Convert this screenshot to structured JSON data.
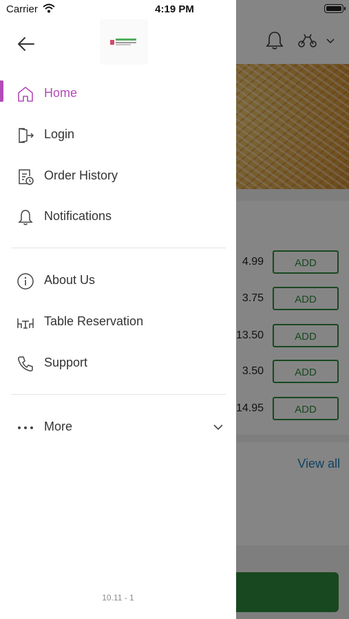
{
  "status_bar": {
    "carrier": "Carrier",
    "time": "4:19 PM"
  },
  "drawer": {
    "menu_primary": [
      {
        "label": "Home",
        "icon": "home-icon",
        "active": true
      },
      {
        "label": "Login",
        "icon": "login-icon"
      },
      {
        "label": "Order History",
        "icon": "order-history-icon"
      },
      {
        "label": "Notifications",
        "icon": "bell-icon"
      }
    ],
    "menu_secondary": [
      {
        "label": "About Us",
        "icon": "info-icon"
      },
      {
        "label": "Table Reservation",
        "icon": "table-icon"
      },
      {
        "label": "Support",
        "icon": "phone-icon"
      }
    ],
    "more": {
      "label": "More",
      "icon": "more-dots-icon"
    },
    "version": "10.11 - 1"
  },
  "background": {
    "prices": [
      "4.99",
      "3.75",
      "13.50",
      "3.50",
      "14.95"
    ],
    "add_label": "ADD",
    "view_all": "View all"
  },
  "colors": {
    "accent": "#b14bb5",
    "green": "#2f8a3c",
    "link": "#1f7fb8"
  }
}
